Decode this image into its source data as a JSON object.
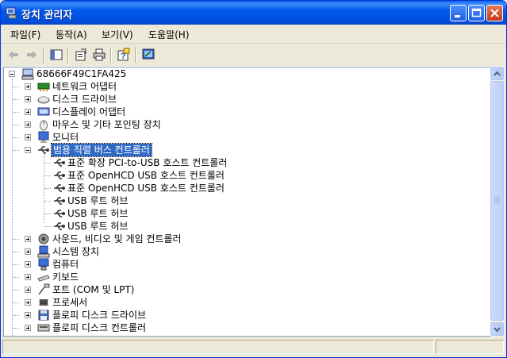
{
  "window": {
    "title": "장치 관리자"
  },
  "menu": [
    {
      "label": "파일(F)"
    },
    {
      "label": "동작(A)"
    },
    {
      "label": "보기(V)"
    },
    {
      "label": "도움말(H)"
    }
  ],
  "tree": {
    "root": "68666F49C1FA425",
    "categories": [
      {
        "label": "네트워크 어댑터",
        "icon": "network-adapter-icon",
        "expanded": false
      },
      {
        "label": "디스크 드라이브",
        "icon": "disk-drive-icon",
        "expanded": false
      },
      {
        "label": "디스플레이 어댑터",
        "icon": "display-adapter-icon",
        "expanded": false
      },
      {
        "label": "마우스 및 기타 포인팅 장치",
        "icon": "mouse-icon",
        "expanded": false
      },
      {
        "label": "모니터",
        "icon": "monitor-icon",
        "expanded": false
      },
      {
        "label": "범용 직렬 버스 컨트롤러",
        "icon": "usb-icon",
        "expanded": true,
        "selected": true,
        "children": [
          "표준 확장 PCI-to-USB 호스트 컨트롤러",
          "표준 OpenHCD USB 호스트 컨트롤러",
          "표준 OpenHCD USB 호스트 컨트롤러",
          "USB 루트 허브",
          "USB 루트 허브",
          "USB 루트 허브"
        ]
      },
      {
        "label": "사운드, 비디오 및 게임 컨트롤러",
        "icon": "sound-icon",
        "expanded": false
      },
      {
        "label": "시스템 장치",
        "icon": "system-device-icon",
        "expanded": false
      },
      {
        "label": "컴퓨터",
        "icon": "computer-icon",
        "expanded": false
      },
      {
        "label": "키보드",
        "icon": "keyboard-icon",
        "expanded": false
      },
      {
        "label": "포트 (COM 및 LPT)",
        "icon": "port-icon",
        "expanded": false
      },
      {
        "label": "프로세서",
        "icon": "processor-icon",
        "expanded": false
      },
      {
        "label": "플로피 디스크 드라이브",
        "icon": "floppy-drive-icon",
        "expanded": false
      },
      {
        "label": "플로피 디스크 컨트롤러",
        "icon": "floppy-controller-icon",
        "expanded": false
      }
    ]
  },
  "colors": {
    "selection": "#316AC5",
    "titlebar": "#0058EE"
  }
}
